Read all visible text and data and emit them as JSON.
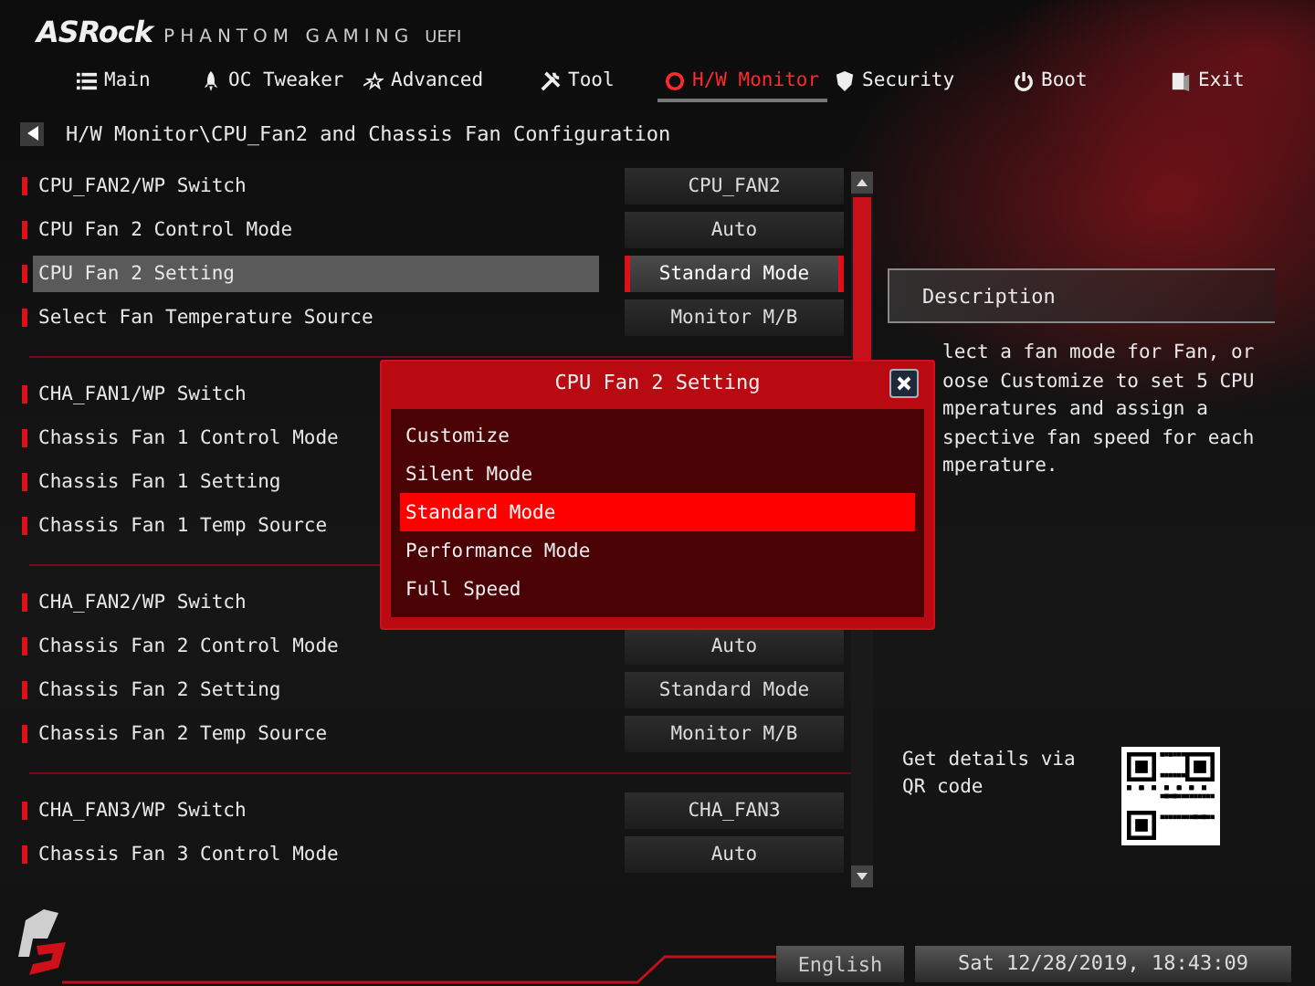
{
  "header": {
    "brand": "ASRock",
    "product": "PHANTOM GAMING",
    "suffix": "UEFI"
  },
  "tabs": [
    {
      "label": "Main",
      "selected": false
    },
    {
      "label": "OC Tweaker",
      "selected": false
    },
    {
      "label": "Advanced",
      "selected": false
    },
    {
      "label": "Tool",
      "selected": false
    },
    {
      "label": "H/W Monitor",
      "selected": true
    },
    {
      "label": "Security",
      "selected": false
    },
    {
      "label": "Boot",
      "selected": false
    },
    {
      "label": "Exit",
      "selected": false
    }
  ],
  "breadcrumb": "H/W Monitor\\CPU_Fan2 and Chassis Fan Configuration",
  "groups": [
    {
      "items": [
        {
          "label": "CPU_FAN2/WP Switch",
          "value": "CPU_FAN2",
          "selected": false
        },
        {
          "label": "CPU Fan 2 Control Mode",
          "value": "Auto",
          "selected": false
        },
        {
          "label": "CPU Fan 2 Setting",
          "value": "Standard Mode",
          "selected": true
        },
        {
          "label": "Select Fan Temperature Source",
          "value": "Monitor M/B",
          "selected": false
        }
      ]
    },
    {
      "items": [
        {
          "label": "CHA_FAN1/WP Switch",
          "selected": false
        },
        {
          "label": "Chassis Fan 1 Control Mode",
          "selected": false
        },
        {
          "label": "Chassis Fan 1 Setting",
          "selected": false
        },
        {
          "label": "Chassis Fan 1 Temp Source",
          "selected": false
        }
      ]
    },
    {
      "items": [
        {
          "label": "CHA_FAN2/WP Switch",
          "selected": false
        },
        {
          "label": "Chassis Fan 2 Control Mode",
          "value": "Auto",
          "selected": false
        },
        {
          "label": "Chassis Fan 2 Setting",
          "value": "Standard Mode",
          "selected": false
        },
        {
          "label": "Chassis Fan 2 Temp Source",
          "value": "Monitor M/B",
          "selected": false
        }
      ]
    },
    {
      "items": [
        {
          "label": "CHA_FAN3/WP Switch",
          "value": "CHA_FAN3",
          "selected": false
        },
        {
          "label": "Chassis Fan 3 Control Mode",
          "value": "Auto",
          "selected": false
        }
      ]
    }
  ],
  "description": {
    "title": "Description",
    "lines": [
      "lect a fan mode for Fan, or",
      "oose Customize to set 5 CPU",
      "mperatures and assign a",
      "spective fan speed for each",
      "mperature."
    ]
  },
  "qr": {
    "text": "Get details via QR code"
  },
  "popup": {
    "title": "CPU Fan 2 Setting",
    "options": [
      {
        "label": "Customize",
        "selected": false
      },
      {
        "label": "Silent Mode",
        "selected": false
      },
      {
        "label": "Standard Mode",
        "selected": true
      },
      {
        "label": "Performance Mode",
        "selected": false
      },
      {
        "label": "Full Speed",
        "selected": false
      }
    ]
  },
  "footer": {
    "language": "English",
    "datetime": "Sat 12/28/2019, 18:43:09"
  }
}
